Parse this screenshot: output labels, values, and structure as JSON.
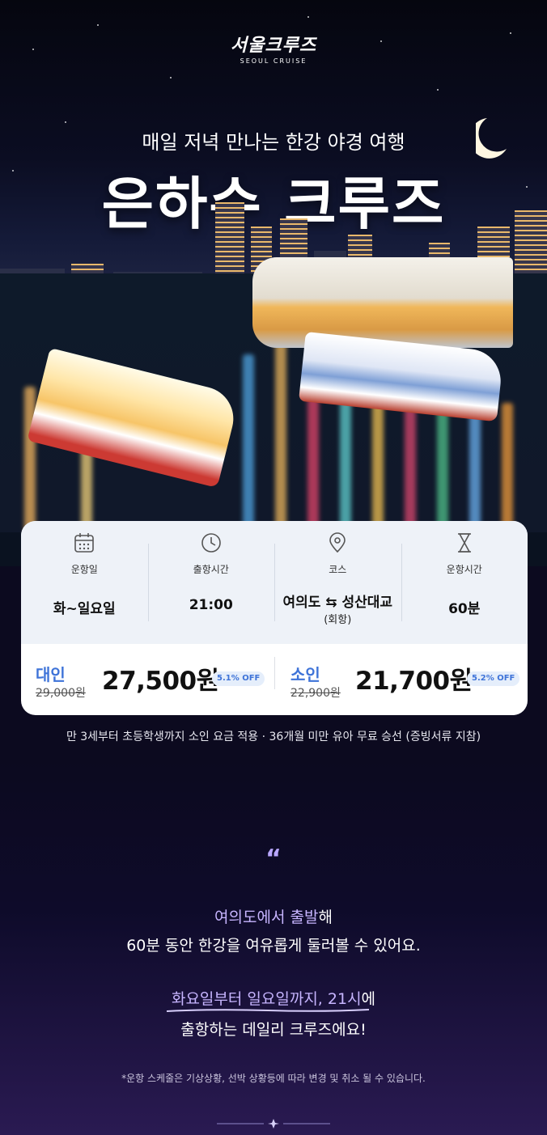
{
  "brand": {
    "logo_main": "서울크루즈",
    "logo_sub": "SEOUL CRUISE"
  },
  "hero": {
    "subtitle": "매일 저녁 만나는 한강 야경 여행",
    "title": "은하수 크루즈"
  },
  "info": [
    {
      "icon": "calendar-icon",
      "label": "운항일",
      "value": "화~일요일",
      "sub": ""
    },
    {
      "icon": "clock-icon",
      "label": "출항시간",
      "value": "21:00",
      "sub": ""
    },
    {
      "icon": "location-pin-icon",
      "label": "코스",
      "value": "여의도 ⇆ 성산대교",
      "sub": "(회항)"
    },
    {
      "icon": "hourglass-icon",
      "label": "운항시간",
      "value": "60분",
      "sub": ""
    }
  ],
  "prices": {
    "adult": {
      "label": "대인",
      "original": "29,000원",
      "price": "27,500원",
      "discount": "5.1% OFF"
    },
    "child": {
      "label": "소인",
      "original": "22,900원",
      "price": "21,700원",
      "discount": "5.2% OFF"
    }
  },
  "note_child": "만 3세부터 초등학생까지 소인 요금 적용 · 36개월 미만 유아 무료 승선 (증빙서류 지참)",
  "description": {
    "quote_mark": "“",
    "line1_highlight": "여의도에서 출발",
    "line1_rest": "해",
    "line2": "60분 동안 한강을 여유롭게 둘러볼 수 있어요.",
    "line3_highlight": "화요일부터 일요일까지, 21시",
    "line3_rest": "에",
    "line4": "출항하는 데일리 크루즈에요!"
  },
  "schedule_note": "*운항 스케줄은 기상상황, 선박 상황등에 따라 변경 및 취소 될 수 있습니다.",
  "colors": {
    "accent": "#3e73d8",
    "highlight": "#c7b5ff",
    "background": "#0c0a1f"
  }
}
